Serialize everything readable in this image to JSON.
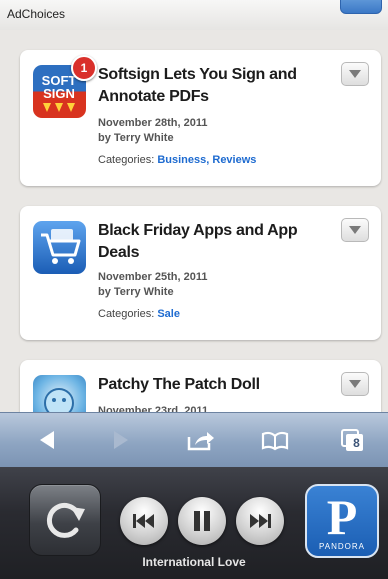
{
  "ad": {
    "label": "AdChoices"
  },
  "articles": [
    {
      "title": "Softsign Lets You Sign and Annotate PDFs",
      "date": "November 28th, 2011",
      "author": "by Terry White",
      "categories_label": "Categories:",
      "categories": [
        "Business",
        "Reviews"
      ],
      "icon": "softsign-app-icon",
      "badge": "1"
    },
    {
      "title": "Black Friday Apps and App Deals",
      "date": "November 25th, 2011",
      "author": "by Terry White",
      "categories_label": "Categories:",
      "categories": [
        "Sale"
      ],
      "icon": "shopping-cart-app-icon"
    },
    {
      "title": "Patchy The Patch Doll",
      "date": "November 23rd, 2011",
      "icon": "patchy-app-icon"
    }
  ],
  "toolbar": {
    "tabs_count": "8"
  },
  "music": {
    "track": "International Love",
    "app_name": "PANDORA",
    "app_letter": "P"
  },
  "colors": {
    "link": "#1e6bd0",
    "badge": "#d9302b",
    "toolbar": "#8ea5c2"
  }
}
